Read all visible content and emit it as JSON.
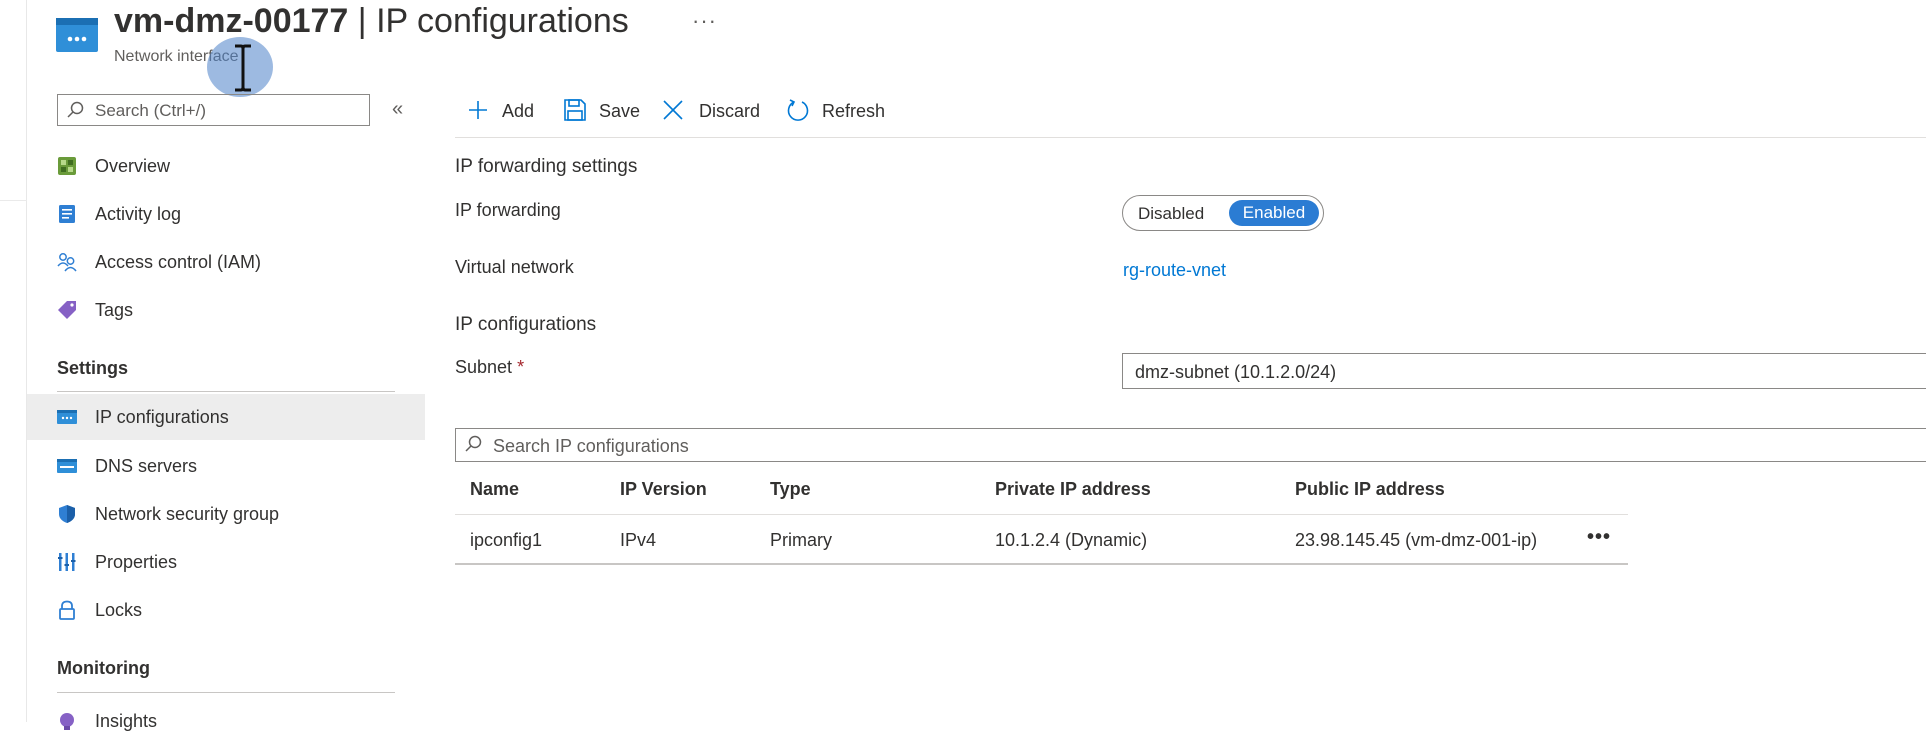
{
  "header": {
    "resource_name": "vm-dmz-00177",
    "separator": "|",
    "page_name": "IP configurations",
    "subtitle": "Network interface",
    "more_label": "···"
  },
  "sidebar": {
    "search_placeholder": "Search (Ctrl+/)",
    "collapse_label": "«",
    "items": [
      {
        "label": "Overview",
        "icon": "overview-icon"
      },
      {
        "label": "Activity log",
        "icon": "activity-log-icon"
      },
      {
        "label": "Access control (IAM)",
        "icon": "people-icon"
      },
      {
        "label": "Tags",
        "icon": "tag-icon"
      }
    ],
    "settings_heading": "Settings",
    "settings_items": [
      {
        "label": "IP configurations",
        "icon": "network-card-icon",
        "selected": true
      },
      {
        "label": "DNS servers",
        "icon": "dns-server-icon"
      },
      {
        "label": "Network security group",
        "icon": "shield-icon"
      },
      {
        "label": "Properties",
        "icon": "properties-bars-icon"
      },
      {
        "label": "Locks",
        "icon": "lock-icon"
      }
    ],
    "monitoring_heading": "Monitoring",
    "monitoring_items": [
      {
        "label": "Insights",
        "icon": "insights-icon"
      }
    ]
  },
  "toolbar": {
    "add": "Add",
    "save": "Save",
    "discard": "Discard",
    "refresh": "Refresh"
  },
  "main": {
    "ip_forwarding_settings_title": "IP forwarding settings",
    "ip_forwarding_label": "IP forwarding",
    "toggle": {
      "off": "Disabled",
      "on": "Enabled",
      "selected": "Enabled"
    },
    "virtual_network_label": "Virtual network",
    "virtual_network_value": "rg-route-vnet",
    "ip_configurations_title": "IP configurations",
    "subnet_label": "Subnet",
    "subnet_required": "*",
    "subnet_value": "dmz-subnet (10.1.2.0/24)",
    "search_placeholder": "Search IP configurations",
    "table": {
      "columns": [
        "Name",
        "IP Version",
        "Type",
        "Private IP address",
        "Public IP address"
      ],
      "rows": [
        [
          "ipconfig1",
          "IPv4",
          "Primary",
          "10.1.2.4 (Dynamic)",
          "23.98.145.45 (vm-dmz-001-ip)"
        ]
      ],
      "row_more": "•••"
    }
  },
  "colors": {
    "accent": "#0078d4",
    "toggle_on": "#2b7cd3",
    "selected_nav_bg": "#ededed",
    "required": "#a4262c"
  }
}
